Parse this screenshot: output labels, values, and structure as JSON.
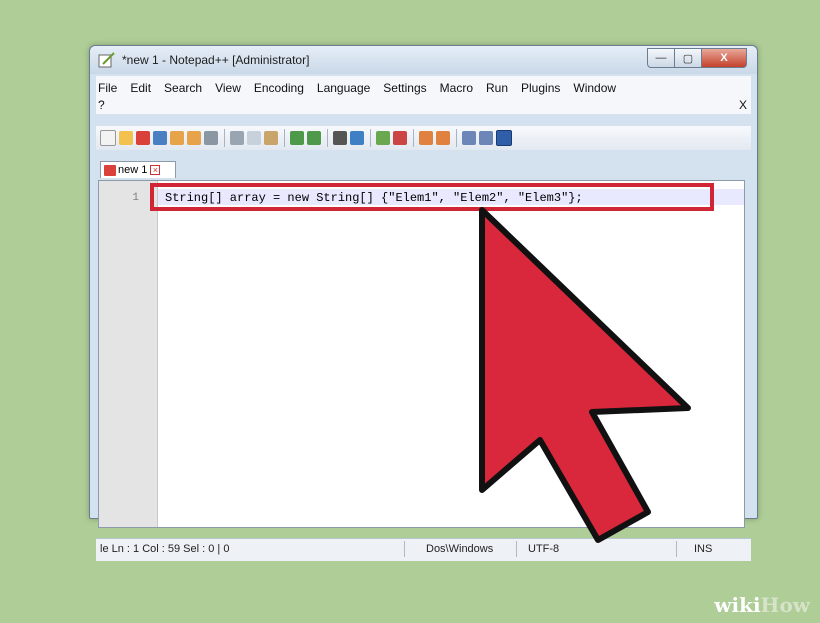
{
  "window": {
    "title": "*new 1 - Notepad++ [Administrator]",
    "buttons": {
      "minimize": "—",
      "maximize": "▢",
      "close": "X"
    }
  },
  "menubar": {
    "items": [
      "File",
      "Edit",
      "Search",
      "View",
      "Encoding",
      "Language",
      "Settings",
      "Macro",
      "Run",
      "Plugins",
      "Window"
    ],
    "help": "?",
    "close": "X"
  },
  "toolbar": {
    "icons": [
      "new-file-icon",
      "open-file-icon",
      "save-icon",
      "save-all-icon",
      "close-icon",
      "close-all-icon",
      "print-icon",
      "cut-icon",
      "copy-icon",
      "paste-icon",
      "undo-icon",
      "redo-icon",
      "find-icon",
      "replace-icon",
      "zoom-in-icon",
      "zoom-out-icon",
      "sync-v-icon",
      "sync-h-icon",
      "wrap-icon",
      "all-chars-icon",
      "indent-guide-icon"
    ]
  },
  "tab": {
    "label": "new 1"
  },
  "editor": {
    "line_number": "1",
    "code": "String[] array = new String[] {\"Elem1\", \"Elem2\", \"Elem3\"};"
  },
  "statusbar": {
    "position": "le Ln : 1   Col : 59   Sel : 0 | 0",
    "eol": "Dos\\Windows",
    "encoding": "UTF-8",
    "mode": "INS"
  },
  "watermark": {
    "wiki": "wiki",
    "how": "How"
  },
  "colors": {
    "background": "#aecd97",
    "highlight": "#d02535",
    "arrow": "#d9273b"
  }
}
